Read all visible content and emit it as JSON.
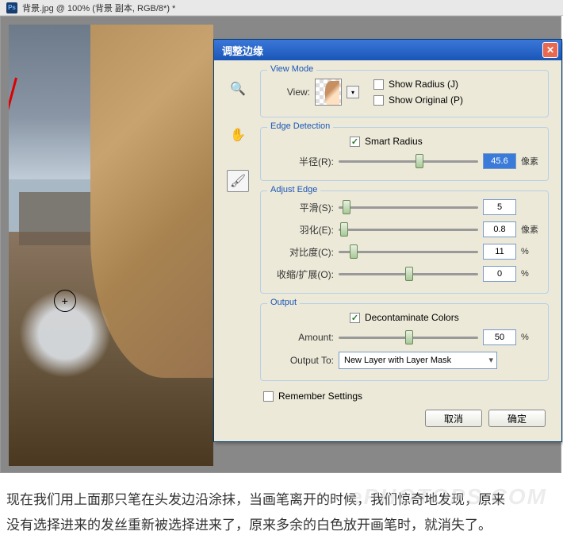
{
  "window": {
    "title": "背景.jpg @ 100% (背景 副本, RGB/8*) *"
  },
  "dialog": {
    "title": "调整边缘",
    "viewMode": {
      "legend": "View Mode",
      "viewLabel": "View:",
      "showRadius": "Show Radius (J)",
      "showOriginal": "Show Original (P)"
    },
    "edgeDetection": {
      "legend": "Edge Detection",
      "smartRadius": "Smart Radius",
      "radiusLabel": "半径(R):",
      "radiusValue": "45.6",
      "radiusUnit": "像素"
    },
    "adjustEdge": {
      "legend": "Adjust Edge",
      "smoothLabel": "平滑(S):",
      "smoothValue": "5",
      "featherLabel": "羽化(E):",
      "featherValue": "0.8",
      "featherUnit": "像素",
      "contrastLabel": "对比度(C):",
      "contrastValue": "11",
      "contrastUnit": "%",
      "shiftLabel": "收缩/扩展(O):",
      "shiftValue": "0",
      "shiftUnit": "%"
    },
    "output": {
      "legend": "Output",
      "decontaminate": "Decontaminate Colors",
      "amountLabel": "Amount:",
      "amountValue": "50",
      "amountUnit": "%",
      "outputToLabel": "Output To:",
      "outputToValue": "New Layer with Layer Mask"
    },
    "remember": "Remember Settings",
    "cancel": "取消",
    "ok": "确定"
  },
  "caption": {
    "line1": "现在我们用上面那只笔在头发边沿涂抹，当画笔离开的时候，我们惊奇地发现，原来",
    "line2": "没有选择进来的发丝重新被选择进来了，原来多余的白色放开画笔时，就消失了。"
  },
  "watermark": "ePHOTOPS.COM"
}
